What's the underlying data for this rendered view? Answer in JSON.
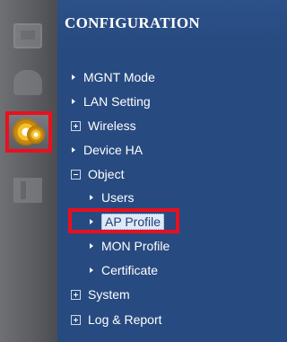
{
  "sidebar": {
    "items": [
      {
        "icon": "monitor-icon",
        "selected": false
      },
      {
        "icon": "dashboard-icon",
        "selected": false
      },
      {
        "icon": "gear-icon",
        "selected": true
      },
      {
        "icon": "maintenance-icon",
        "selected": false
      }
    ]
  },
  "menu": {
    "title": "CONFIGURATION",
    "items": [
      {
        "label": "MGNT Mode"
      },
      {
        "label": "LAN Setting"
      },
      {
        "label": "Wireless"
      },
      {
        "label": "Device HA"
      },
      {
        "label": "Object"
      },
      {
        "label": "Users"
      },
      {
        "label": "AP Profile"
      },
      {
        "label": "MON Profile"
      },
      {
        "label": "Certificate"
      },
      {
        "label": "System"
      },
      {
        "label": "Log & Report"
      }
    ],
    "selected_item": "AP Profile"
  },
  "colors": {
    "panel_bg": "#274a80",
    "rail_bg": "#5b5c60",
    "highlight_border": "#e8101e",
    "selected_bg": "#dfe9f7"
  }
}
